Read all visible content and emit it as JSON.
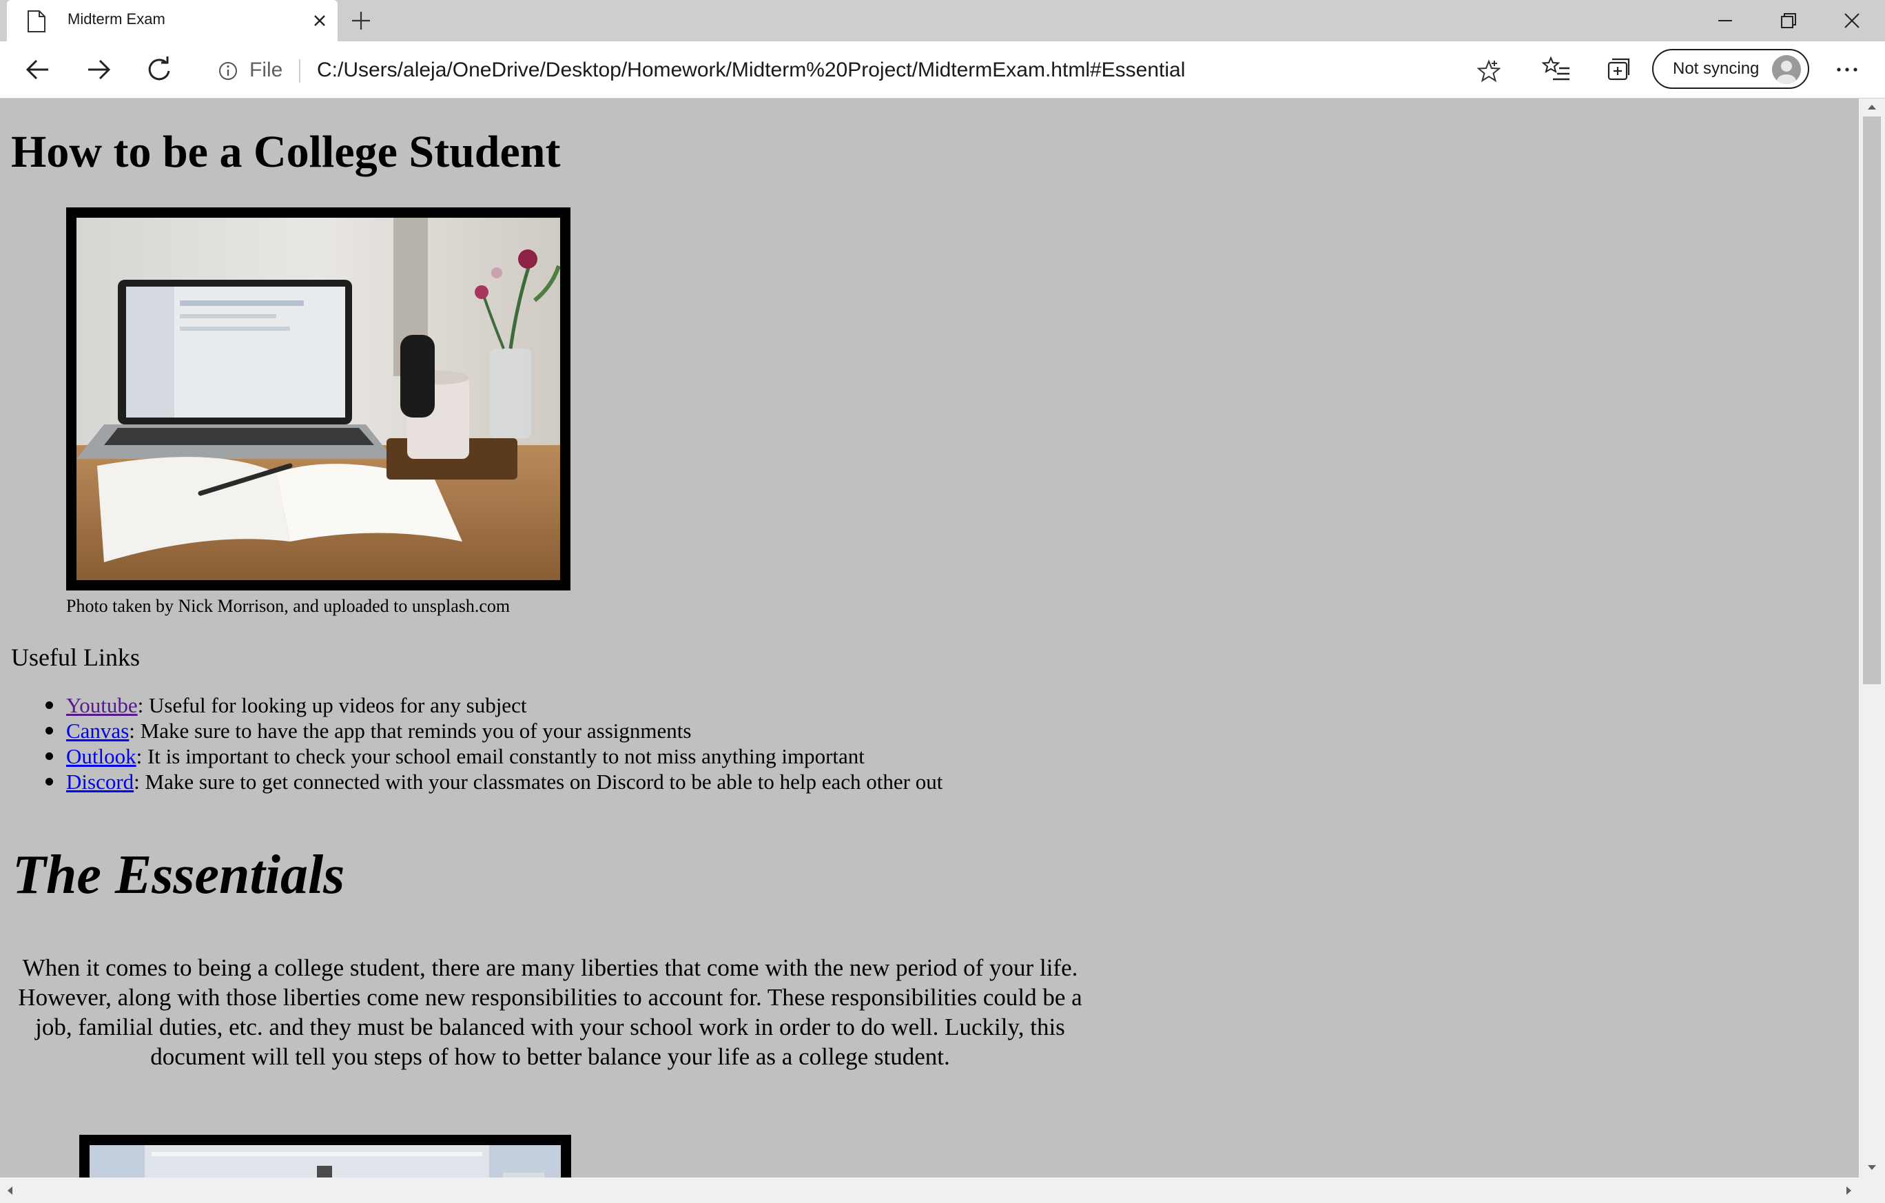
{
  "tab": {
    "title": "Midterm Exam"
  },
  "address_bar": {
    "scheme_label": "File",
    "url": "C:/Users/aleja/OneDrive/Desktop/Homework/Midterm%20Project/MidtermExam.html#Essential"
  },
  "profile": {
    "sync_label": "Not syncing"
  },
  "icons": {
    "tab": "page-icon",
    "tab_close": "close-icon",
    "new_tab": "plus-icon",
    "back": "arrow-left-icon",
    "forward": "arrow-right-icon",
    "refresh": "refresh-icon",
    "info": "info-icon",
    "favorite": "star-icon",
    "favorites_list": "favorites-icon",
    "collections": "collections-icon",
    "more": "more-icon"
  },
  "page": {
    "title": "How to be a College Student",
    "photo_caption": "Photo taken by Nick Morrison, and uploaded to unsplash.com",
    "links_heading": "Useful Links",
    "links": [
      {
        "label": "Youtube",
        "description": ": Useful for looking up videos for any subject",
        "visited": true
      },
      {
        "label": "Canvas",
        "description": ": Make sure to have the app that reminds you of your assignments",
        "visited": false
      },
      {
        "label": "Outlook",
        "description": ": It is important to check your school email constantly to not miss anything important",
        "visited": false
      },
      {
        "label": "Discord",
        "description": ": Make sure to get connected with your classmates on Discord to be able to help each other out",
        "visited": false
      }
    ],
    "section_heading": "The Essentials",
    "paragraph": "When it comes to being a college student, there are many liberties that come with the new period of your life. However, along with those liberties come new responsibilities to account for. These responsibilities could be a job, familial duties, etc. and they must be balanced with your school work in order to do well. Luckily, this document will tell you steps of how to better balance your life as a college student."
  },
  "colors": {
    "page_background": "#c0c0c0",
    "link": "#0000ee",
    "link_visited": "#551a8b",
    "image_border": "#000000"
  }
}
